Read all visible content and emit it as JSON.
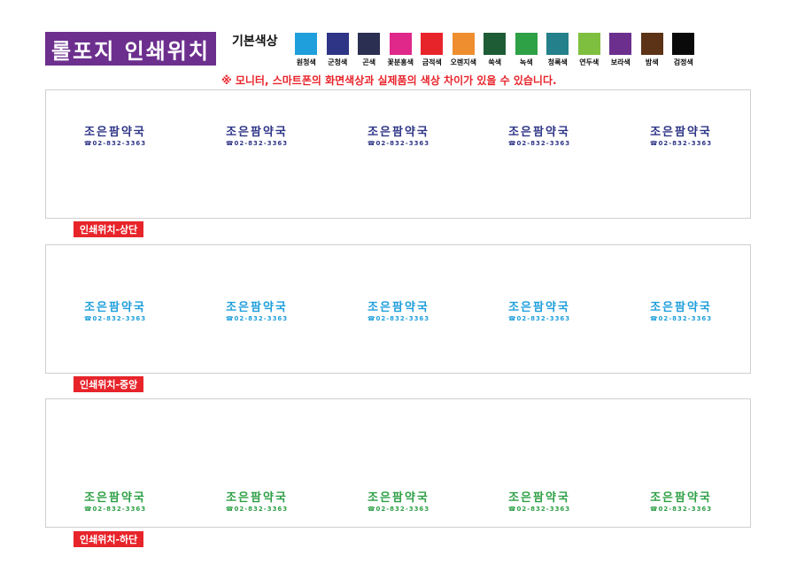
{
  "header": {
    "title": "롤포지 인쇄위치",
    "basic_colors_label": "기본색상",
    "notice": "※ 모니터, 스마트폰의 화면색상과 실제품의 색상 차이가 있을 수 있습니다."
  },
  "swatches": [
    {
      "name": "원청색",
      "color": "#1f9fdc"
    },
    {
      "name": "군청색",
      "color": "#2e3586"
    },
    {
      "name": "곤색",
      "color": "#2b2f52"
    },
    {
      "name": "꽃분홍색",
      "color": "#e0278a"
    },
    {
      "name": "금적색",
      "color": "#e8242b"
    },
    {
      "name": "오렌지색",
      "color": "#ee8e2f"
    },
    {
      "name": "쑥색",
      "color": "#1e5c35"
    },
    {
      "name": "녹색",
      "color": "#2ea046"
    },
    {
      "name": "청록색",
      "color": "#24808a"
    },
    {
      "name": "연두색",
      "color": "#7fbf3f"
    },
    {
      "name": "보라색",
      "color": "#6d2f8e"
    },
    {
      "name": "밤색",
      "color": "#5c3317"
    },
    {
      "name": "검정색",
      "color": "#0a0a0a"
    }
  ],
  "stamp": {
    "shop_name": "조은팜약국",
    "phone": "☎02-832-3363"
  },
  "sections": [
    {
      "tag": "인쇄위치-상단",
      "text_color": "#2e3586"
    },
    {
      "tag": "인쇄위치-중앙",
      "text_color": "#1f9fdc"
    },
    {
      "tag": "인쇄위치-하단",
      "text_color": "#2ea046"
    }
  ]
}
